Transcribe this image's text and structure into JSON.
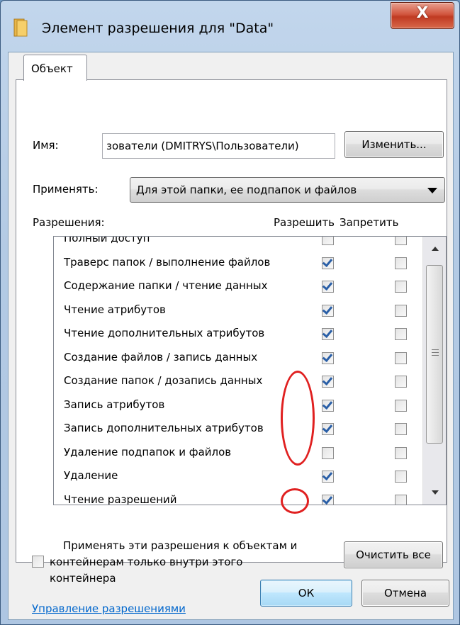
{
  "window": {
    "title": "Элемент разрешения для \"Data\"",
    "close_glyph": "X",
    "folder_icon": "folder-icon",
    "close_icon": "close-icon"
  },
  "tabs": [
    {
      "label": "Объект",
      "active": true
    }
  ],
  "name_field": {
    "label": "Имя:",
    "value": "зователи (DMITRYS\\Пользователи)",
    "change_button": "Изменить..."
  },
  "apply": {
    "label": "Применять:",
    "selected": "Для этой папки, ее подпапок и файлов"
  },
  "permissions": {
    "header": "Разрешения:",
    "allow_header": "Разрешить",
    "deny_header": "Запретить",
    "rows": [
      {
        "name": "Полный доступ",
        "allow": false,
        "deny": false
      },
      {
        "name": "Траверс папок / выполнение файлов",
        "allow": true,
        "deny": false
      },
      {
        "name": "Содержание папки / чтение данных",
        "allow": true,
        "deny": false
      },
      {
        "name": "Чтение атрибутов",
        "allow": true,
        "deny": false
      },
      {
        "name": "Чтение дополнительных атрибутов",
        "allow": true,
        "deny": false
      },
      {
        "name": "Создание файлов / запись данных",
        "allow": true,
        "deny": false
      },
      {
        "name": "Создание папок / дозапись данных",
        "allow": true,
        "deny": false
      },
      {
        "name": "Запись атрибутов",
        "allow": true,
        "deny": false
      },
      {
        "name": "Запись дополнительных атрибутов",
        "allow": true,
        "deny": false
      },
      {
        "name": "Удаление подпапок и файлов",
        "allow": false,
        "deny": false
      },
      {
        "name": "Удаление",
        "allow": true,
        "deny": false
      },
      {
        "name": "Чтение разрешений",
        "allow": true,
        "deny": false
      }
    ]
  },
  "apply_inside": {
    "text_line1": "Применять эти разрешения к объектам и",
    "text_line2": "контейнерам только внутри этого",
    "text_line3": "контейнера",
    "checked": false
  },
  "clear_all_button": "Очистить все",
  "manage_link": "Управление разрешениями",
  "buttons": {
    "ok": "ОК",
    "cancel": "Отмена"
  },
  "colors": {
    "annotation": "#e02020",
    "link": "#0066cc",
    "check": "#2a5fa7"
  }
}
